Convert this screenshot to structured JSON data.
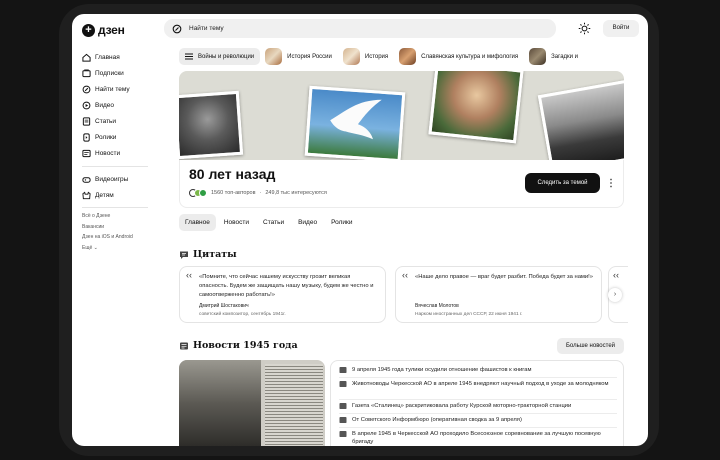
{
  "app": {
    "logo": "дзен"
  },
  "sidebar": {
    "items": [
      {
        "label": "Главная",
        "icon": "home-icon"
      },
      {
        "label": "Подписки",
        "icon": "subscriptions-icon"
      },
      {
        "label": "Найти тему",
        "icon": "find-topic-icon"
      },
      {
        "label": "Видео",
        "icon": "video-icon"
      },
      {
        "label": "Статьи",
        "icon": "articles-icon"
      },
      {
        "label": "Ролики",
        "icon": "shorts-icon"
      },
      {
        "label": "Новости",
        "icon": "news-icon"
      }
    ],
    "items2": [
      {
        "label": "Видеоигры",
        "icon": "gamepad-icon"
      },
      {
        "label": "Детям",
        "icon": "kids-icon"
      }
    ],
    "footer": [
      "Всё о Дзене",
      "Вакансии",
      "Дзен на iOS и Android",
      "Ещё ⌄"
    ]
  },
  "search": {
    "placeholder": "Найти тему"
  },
  "header": {
    "login_label": "Войти"
  },
  "tags": [
    {
      "label": "Войны и революции",
      "active": true
    },
    {
      "label": "История России"
    },
    {
      "label": "История"
    },
    {
      "label": "Славянская культура и мифология"
    },
    {
      "label": "Загадки и"
    }
  ],
  "topic": {
    "title": "80 лет назад",
    "authors": "1560 топ-авторов",
    "interested": "249,8 тыс интересуются",
    "follow_label": "Следить за темой"
  },
  "tabs": [
    "Главное",
    "Новости",
    "Статьи",
    "Видео",
    "Ролики"
  ],
  "quotes": {
    "title": "Цитаты",
    "items": [
      {
        "text": "«Помните, что сейчас нашему искусству грозит великая опасность. Будем же защищать нашу музыку, будем же честно и самоотверженно работать!»",
        "author": "Дмитрий Шостакович",
        "role": "советский композитор, сентябрь 1941г."
      },
      {
        "text": "«Наше дело правое — враг будет разбит. Победа будет за нами!»",
        "author": "Вячеслав Молотов",
        "role": "Нарком иностранных дел СССР, 22 июня 1941 г."
      }
    ]
  },
  "news": {
    "title": "Новости 1945 года",
    "more_label": "Больше новостей",
    "items": [
      "9 апреля 1945 года тулики осудили отношение фашистов к книгам",
      "Животноводы Черкесской АО в апреле 1945 внедряют научный подход в уходе за молодняком",
      "Газета «Сталинец» раскритиковала работу Курской моторно-тракторной станции",
      "От Советского Информбюро (оперативная сводка за 9 апреля)",
      "В апреле 1945 в Черкесской АО проходило Всесоюзное соревнование за лучшую посевную бригаду"
    ]
  }
}
